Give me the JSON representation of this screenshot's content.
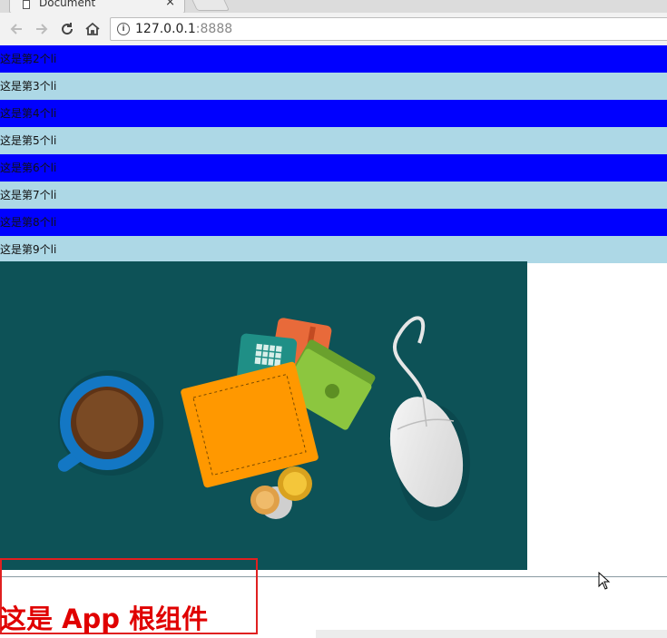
{
  "browser": {
    "tab": {
      "title": "Document",
      "close_glyph": "×"
    },
    "nav": {
      "back": "←",
      "forward": "→",
      "reload": "↻"
    },
    "address": {
      "host": "127.0.0.1",
      "port": ":8888",
      "info_glyph": "i"
    }
  },
  "page": {
    "list_items": [
      {
        "label": "这是第2个li",
        "color": "#0000ff"
      },
      {
        "label": "这是第3个li",
        "color": "#add8e6"
      },
      {
        "label": "这是第4个li",
        "color": "#0000ff"
      },
      {
        "label": "这是第5个li",
        "color": "#add8e6"
      },
      {
        "label": "这是第6个li",
        "color": "#0000ff"
      },
      {
        "label": "这是第7个li",
        "color": "#add8e6"
      },
      {
        "label": "这是第8个li",
        "color": "#0000ff"
      },
      {
        "label": "这是第9个li",
        "color": "#add8e6"
      }
    ],
    "image": {
      "name": "desk-illustration",
      "background": "#0d5257",
      "objects": [
        "coffee-cup",
        "wallet",
        "cards",
        "banknotes",
        "coins",
        "computer-mouse"
      ]
    },
    "root_component_label": "这是 App 根组件",
    "colors": {
      "heading_red": "#e00000",
      "highlight_box": "#e02020"
    }
  }
}
